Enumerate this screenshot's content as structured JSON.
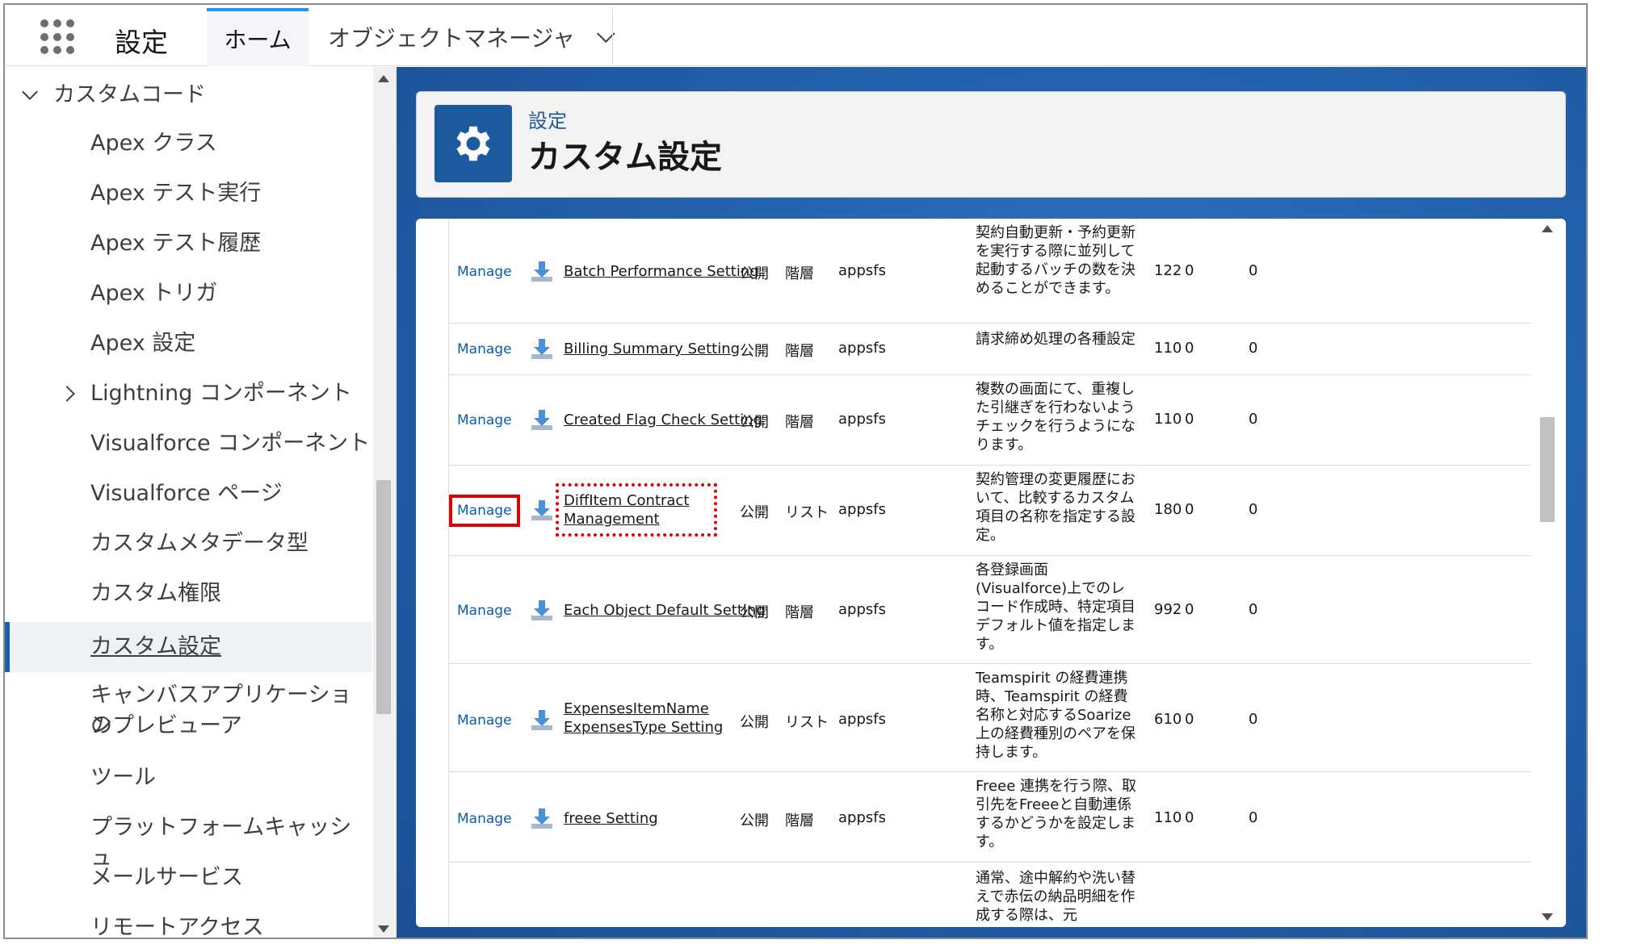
{
  "app": {
    "name": "設定",
    "tabs": [
      {
        "label": "ホーム"
      },
      {
        "label": "オブジェクトマネージャ"
      }
    ]
  },
  "sidebar": {
    "group_label": "カスタムコード",
    "items": [
      {
        "label": "Apex クラス"
      },
      {
        "label": "Apex テスト実行"
      },
      {
        "label": "Apex テスト履歴"
      },
      {
        "label": "Apex トリガ"
      },
      {
        "label": "Apex 設定"
      },
      {
        "label": "Lightning コンポーネント"
      },
      {
        "label": "Visualforce コンポーネント"
      },
      {
        "label": "Visualforce ページ"
      },
      {
        "label": "カスタムメタデータ型"
      },
      {
        "label": "カスタム権限"
      },
      {
        "label": "カスタム設定"
      },
      {
        "label": "キャンバスアプリケーション"
      },
      {
        "label": "のプレビューア"
      },
      {
        "label": "ツール"
      },
      {
        "label": "プラットフォームキャッシュ"
      },
      {
        "label": "メールサービス"
      },
      {
        "label": "リモートアクセス"
      }
    ]
  },
  "header": {
    "breadcrumb": "設定",
    "title": "カスタム設定"
  },
  "rows": [
    {
      "manage": "Manage",
      "label": "Batch Performance Setting",
      "visibility": "公開",
      "type": "階層",
      "namespace": "appsfs",
      "description": "契約自動更新・予約更新を実行する際に並列して起動するバッチの数を決めることができます。",
      "size": "122",
      "count": "0",
      "records": "0"
    },
    {
      "manage": "Manage",
      "label": "Billing Summary Setting",
      "visibility": "公開",
      "type": "階層",
      "namespace": "appsfs",
      "description": "請求締め処理の各種設定",
      "size": "110",
      "count": "0",
      "records": "0"
    },
    {
      "manage": "Manage",
      "label": "Created Flag Check Setting",
      "visibility": "公開",
      "type": "階層",
      "namespace": "appsfs",
      "description": "複数の画面にて、重複した引継ぎを行わないようチェックを行うようになります。",
      "size": "110",
      "count": "0",
      "records": "0"
    },
    {
      "manage": "Manage",
      "label": "DiffItem Contract Management",
      "visibility": "公開",
      "type": "リスト",
      "namespace": "appsfs",
      "description": "契約管理の変更履歴において、比較するカスタム項目の名称を指定する設定。",
      "size": "180",
      "count": "0",
      "records": "0"
    },
    {
      "manage": "Manage",
      "label": "Each Object Default Setting",
      "visibility": "公開",
      "type": "階層",
      "namespace": "appsfs",
      "description": "各登録画面(Visualforce)上でのレコード作成時、特定項目デフォルト値を指定します。",
      "size": "992",
      "count": "0",
      "records": "0"
    },
    {
      "manage": "Manage",
      "label": "ExpensesItemName ExpensesType Setting",
      "visibility": "公開",
      "type": "リスト",
      "namespace": "appsfs",
      "description": "Teamspirit の経費連携時、Teamspirit の経費名称と対応するSoarize上の経費種別のペアを保持します。",
      "size": "610",
      "count": "0",
      "records": "0"
    },
    {
      "manage": "Manage",
      "label": "freee Setting",
      "visibility": "公開",
      "type": "階層",
      "namespace": "appsfs",
      "description": "Freee 連携を行う際、取引先をFreeeと自動連係するかどうかを設定します。",
      "size": "110",
      "count": "0",
      "records": "0"
    },
    {
      "manage": "",
      "label": "",
      "visibility": "",
      "type": "",
      "namespace": "",
      "description": "通常、途中解約や洗い替えで赤伝の納品明細を作成する際は、元",
      "size": "",
      "count": "",
      "records": ""
    }
  ]
}
